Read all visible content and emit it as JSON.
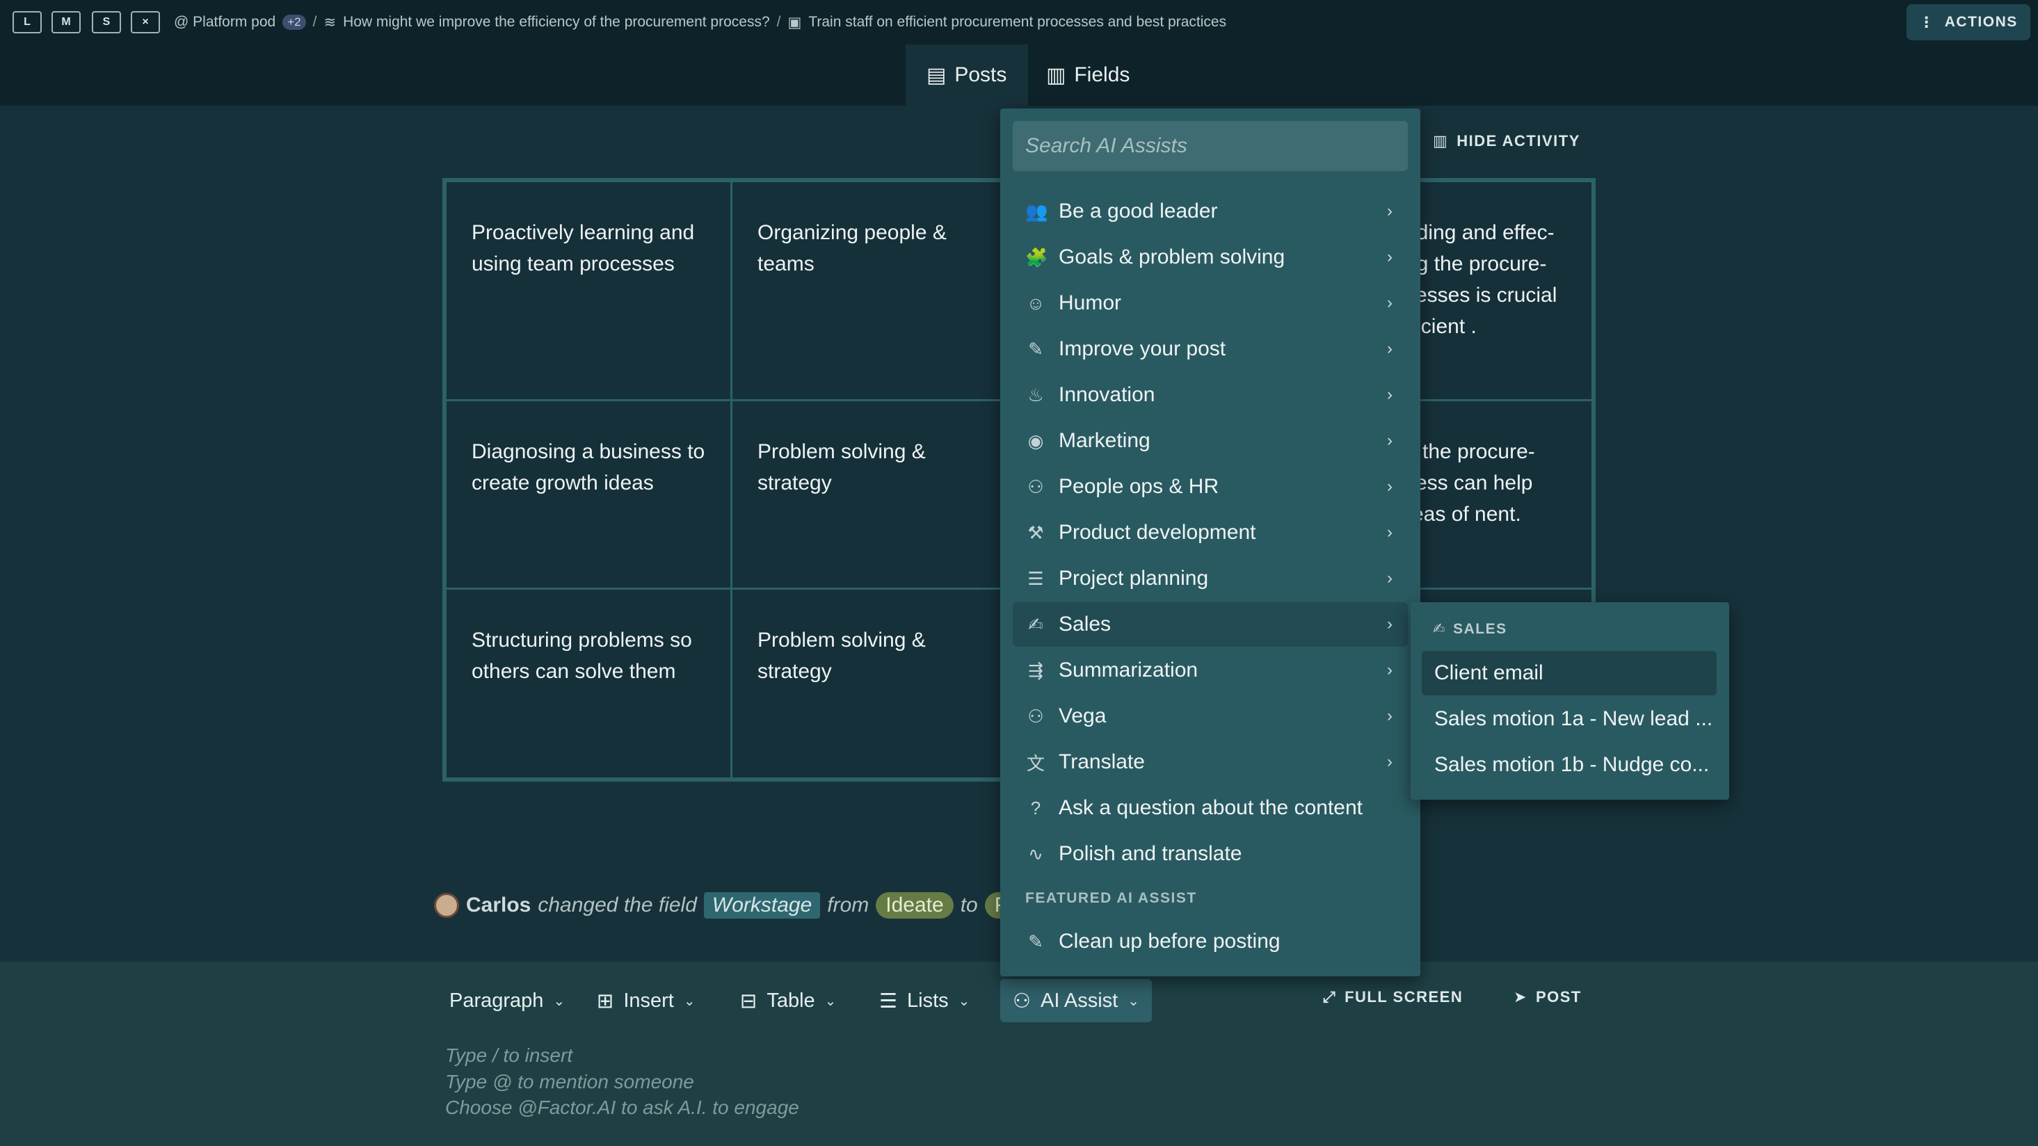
{
  "topbar": {
    "layouts": [
      "L",
      "M",
      "S",
      "×"
    ],
    "breadcrumb": {
      "workspace": "@ Platform pod",
      "workspace_badge": "+2",
      "question": "How might we improve the efficiency of the procurement process?",
      "post": "Train staff on efficient procurement processes and best practices"
    },
    "actions_label": "ACTIONS"
  },
  "tabs": [
    {
      "label": "Posts",
      "icon": "chat-icon",
      "active": true
    },
    {
      "label": "Fields",
      "icon": "bar-chart-icon",
      "active": false
    }
  ],
  "main": {
    "hide_activity_label": "HIDE ACTIVITY",
    "table": {
      "rows": [
        [
          "Proactively learning and using team processes",
          "Organizing people & teams",
          "nding and effec-ng the procure-cesses is crucial fficient ."
        ],
        [
          "Diagnosing a business to create growth ideas",
          "Problem solving & strategy",
          "g the procure-cess can help reas of nent."
        ],
        [
          "Structuring problems so others can solve them",
          "Problem solving & strategy",
          ""
        ]
      ]
    },
    "activity": {
      "user": "Carlos",
      "verb": "changed the field",
      "field": "Workstage",
      "from_word": "from",
      "from_value": "Ideate",
      "to_word": "to",
      "to_value": "Plan"
    }
  },
  "ai_menu": {
    "search_placeholder": "Search AI Assists",
    "items": [
      {
        "label": "Be a good leader",
        "icon": "people-icon",
        "glyph": "👥"
      },
      {
        "label": "Goals & problem solving",
        "icon": "puzzle-icon",
        "glyph": "🧩"
      },
      {
        "label": "Humor",
        "icon": "smiley-icon",
        "glyph": "☺"
      },
      {
        "label": "Improve your post",
        "icon": "feather-icon",
        "glyph": "✎"
      },
      {
        "label": "Innovation",
        "icon": "flame-icon",
        "glyph": "♨"
      },
      {
        "label": "Marketing",
        "icon": "broadcast-icon",
        "glyph": "◉"
      },
      {
        "label": "People ops & HR",
        "icon": "robot-icon",
        "glyph": "⚇"
      },
      {
        "label": "Product development",
        "icon": "tools-icon",
        "glyph": "⚒"
      },
      {
        "label": "Project planning",
        "icon": "timeline-icon",
        "glyph": "☰"
      },
      {
        "label": "Sales",
        "icon": "handshake-icon",
        "glyph": "✍",
        "active": true
      },
      {
        "label": "Summarization",
        "icon": "list-arrow-icon",
        "glyph": "⇶"
      },
      {
        "label": "Vega",
        "icon": "robot-icon",
        "glyph": "⚇"
      },
      {
        "label": "Translate",
        "icon": "translate-icon",
        "glyph": "文"
      },
      {
        "label": "Ask a question about the content",
        "icon": "question-icon",
        "glyph": "?"
      },
      {
        "label": "Polish and translate",
        "icon": "pulse-icon",
        "glyph": "∿"
      }
    ],
    "featured_heading": "FEATURED AI ASSIST",
    "featured_item": {
      "label": "Clean up before posting",
      "icon": "feather-icon",
      "glyph": "✎"
    }
  },
  "sales_submenu": {
    "heading": "SALES",
    "items": [
      "Client email",
      "Sales motion 1a - New lead ...",
      "Sales motion 1b - Nudge co..."
    ]
  },
  "editor": {
    "toolbar": {
      "paragraph": "Paragraph",
      "insert": "Insert",
      "table": "Table",
      "lists": "Lists",
      "ai_assist": "AI Assist",
      "full_screen": "FULL SCREEN",
      "post": "POST"
    },
    "placeholder_lines": [
      "Type / to insert",
      "Type @ to mention someone",
      "Choose @Factor.AI to ask A.I. to engage"
    ]
  }
}
